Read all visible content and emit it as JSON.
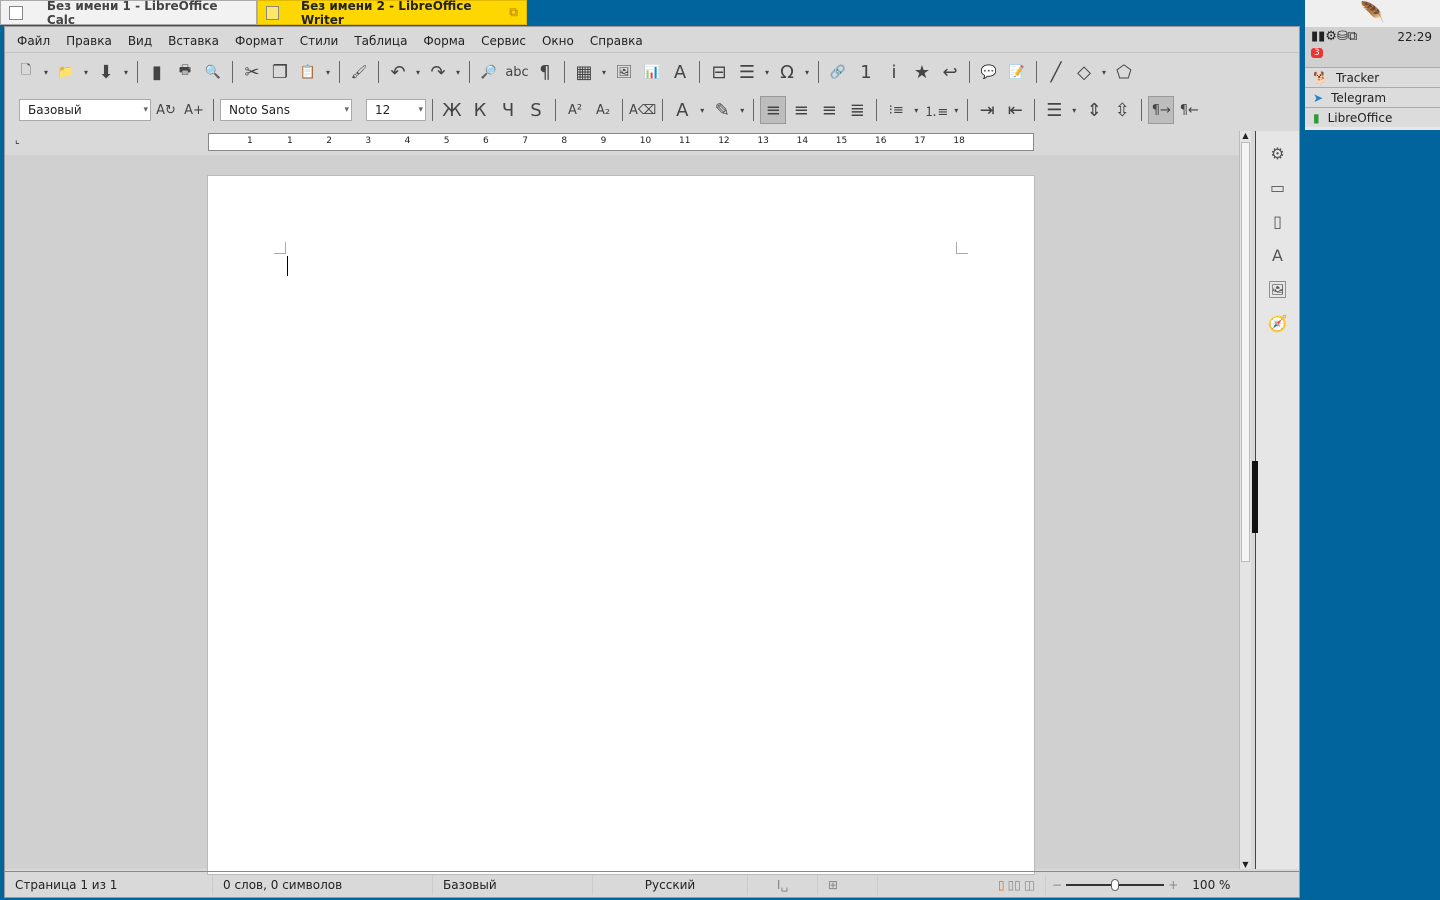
{
  "taskbar": {
    "tasks": [
      {
        "label": "Без имени 1 - LibreOffice Calc",
        "active": false
      },
      {
        "label": "Без имени 2 - LibreOffice Writer",
        "active": true
      }
    ]
  },
  "menu": [
    "Файл",
    "Правка",
    "Вид",
    "Вставка",
    "Формат",
    "Стили",
    "Таблица",
    "Форма",
    "Сервис",
    "Окно",
    "Справка"
  ],
  "toolbar1": [
    {
      "name": "new-document",
      "g": "🗋"
    },
    {
      "name": "new-dropdown",
      "g": "▾",
      "dd": true
    },
    {
      "name": "open",
      "g": "📁"
    },
    {
      "name": "open-dropdown",
      "g": "▾",
      "dd": true
    },
    {
      "name": "save",
      "g": "⬇"
    },
    {
      "name": "save-dropdown",
      "g": "▾",
      "dd": true
    },
    {
      "sep": true
    },
    {
      "name": "export-pdf",
      "g": "▮"
    },
    {
      "name": "print",
      "g": "🖶"
    },
    {
      "name": "print-preview",
      "g": "🔍"
    },
    {
      "sep": true
    },
    {
      "name": "cut",
      "g": "✂"
    },
    {
      "name": "copy",
      "g": "❐"
    },
    {
      "name": "paste",
      "g": "📋"
    },
    {
      "name": "paste-dropdown",
      "g": "▾",
      "dd": true
    },
    {
      "sep": true
    },
    {
      "name": "clone-formatting",
      "g": "🖌"
    },
    {
      "sep": true
    },
    {
      "name": "undo",
      "g": "↶"
    },
    {
      "name": "undo-dropdown",
      "g": "▾",
      "dd": true
    },
    {
      "name": "redo",
      "g": "↷"
    },
    {
      "name": "redo-dropdown",
      "g": "▾",
      "dd": true
    },
    {
      "sep": true
    },
    {
      "name": "find-replace",
      "g": "🔎"
    },
    {
      "name": "spelling",
      "g": "abc"
    },
    {
      "name": "formatting-marks",
      "g": "¶"
    },
    {
      "sep": true
    },
    {
      "name": "insert-table",
      "g": "▦"
    },
    {
      "name": "table-dropdown",
      "g": "▾",
      "dd": true
    },
    {
      "name": "insert-image",
      "g": "🖼"
    },
    {
      "name": "insert-chart",
      "g": "📊"
    },
    {
      "name": "insert-textbox",
      "g": "A"
    },
    {
      "sep": true
    },
    {
      "name": "insert-page-break",
      "g": "⊟"
    },
    {
      "name": "insert-field",
      "g": "☰"
    },
    {
      "name": "field-dropdown",
      "g": "▾",
      "dd": true
    },
    {
      "name": "insert-special-char",
      "g": "Ω"
    },
    {
      "name": "special-char-dropdown",
      "g": "▾",
      "dd": true
    },
    {
      "sep": true
    },
    {
      "name": "insert-hyperlink",
      "g": "🔗"
    },
    {
      "name": "insert-footnote",
      "g": "1"
    },
    {
      "name": "insert-endnote",
      "g": "i"
    },
    {
      "name": "insert-bookmark",
      "g": "★"
    },
    {
      "name": "insert-cross-reference",
      "g": "↩"
    },
    {
      "sep": true
    },
    {
      "name": "insert-comment",
      "g": "💬"
    },
    {
      "name": "track-changes",
      "g": "📝"
    },
    {
      "sep": true
    },
    {
      "name": "insert-line",
      "g": "╱"
    },
    {
      "name": "basic-shapes",
      "g": "◇"
    },
    {
      "name": "shapes-dropdown",
      "g": "▾",
      "dd": true
    },
    {
      "name": "draw-functions",
      "g": "⬠"
    }
  ],
  "toolbar2": {
    "paragraph_style": "Базовый",
    "font_name": "Noto Sans",
    "font_size": "12",
    "buttons_a": [
      {
        "name": "update-style",
        "g": "A↻"
      },
      {
        "name": "new-style",
        "g": "A+"
      }
    ],
    "buttons_b": [
      {
        "name": "bold",
        "g": "Ж"
      },
      {
        "name": "italic",
        "g": "К"
      },
      {
        "name": "underline",
        "g": "Ч"
      },
      {
        "name": "strikethrough",
        "g": "S"
      },
      {
        "sep": true
      },
      {
        "name": "superscript",
        "g": "A²"
      },
      {
        "name": "subscript",
        "g": "A₂"
      },
      {
        "sep": true
      },
      {
        "name": "clear-formatting",
        "g": "A⌫"
      },
      {
        "sep": true
      },
      {
        "name": "font-color",
        "g": "A"
      },
      {
        "name": "font-color-dropdown",
        "g": "▾",
        "dd": true
      },
      {
        "name": "highlighting",
        "g": "✎"
      },
      {
        "name": "highlight-dropdown",
        "g": "▾",
        "dd": true
      },
      {
        "sep": true
      },
      {
        "name": "align-left",
        "g": "≡",
        "pressed": true
      },
      {
        "name": "align-center",
        "g": "≡"
      },
      {
        "name": "align-right",
        "g": "≡"
      },
      {
        "name": "justify",
        "g": "≣"
      },
      {
        "sep": true
      },
      {
        "name": "unordered-list",
        "g": "⁝≡"
      },
      {
        "name": "list-dropdown",
        "g": "▾",
        "dd": true
      },
      {
        "name": "ordered-list",
        "g": "⒈≡"
      },
      {
        "name": "ordered-dropdown",
        "g": "▾",
        "dd": true
      },
      {
        "sep": true
      },
      {
        "name": "increase-indent",
        "g": "⇥"
      },
      {
        "name": "decrease-indent",
        "g": "⇤"
      },
      {
        "sep": true
      },
      {
        "name": "line-spacing",
        "g": "☰"
      },
      {
        "name": "spacing-dropdown",
        "g": "▾",
        "dd": true
      },
      {
        "name": "increase-paragraph-spacing",
        "g": "⇕"
      },
      {
        "name": "decrease-paragraph-spacing",
        "g": "⇳"
      },
      {
        "sep": true
      },
      {
        "name": "left-to-right",
        "g": "¶→",
        "pressed": true
      },
      {
        "name": "right-to-left",
        "g": "¶←"
      }
    ]
  },
  "ruler": [
    "1",
    "1",
    "2",
    "3",
    "4",
    "5",
    "6",
    "7",
    "8",
    "9",
    "10",
    "11",
    "12",
    "13",
    "14",
    "15",
    "16",
    "17",
    "18"
  ],
  "sidebar": [
    {
      "name": "properties",
      "g": "⚙"
    },
    {
      "name": "styles",
      "g": "▭"
    },
    {
      "name": "page",
      "g": "▯"
    },
    {
      "name": "styles-fonts",
      "g": "A"
    },
    {
      "name": "gallery",
      "g": "🖼"
    },
    {
      "name": "navigator",
      "g": "🧭"
    }
  ],
  "status": {
    "page": "Страница 1 из 1",
    "words": "0 слов, 0 символов",
    "style": "Базовый",
    "language": "Русский",
    "zoom": "100 %",
    "zoom_value": 100
  },
  "tray": {
    "clock": "22:29",
    "badge": "3",
    "apps": [
      "Tracker",
      "Telegram",
      "LibreOffice"
    ]
  }
}
